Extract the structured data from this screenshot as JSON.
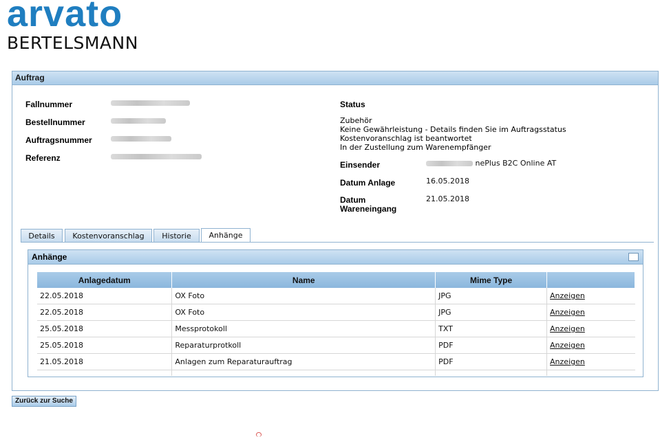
{
  "logo": {
    "brand": "arvato",
    "sub": "BERTELSMANN"
  },
  "panel": {
    "title": "Auftrag"
  },
  "fields": {
    "fallnummer_label": "Fallnummer",
    "bestellnummer_label": "Bestellnummer",
    "auftragsnummer_label": "Auftragsnummer",
    "referenz_label": "Referenz",
    "status_label": "Status",
    "status_lines": [
      "Zubehör",
      "Keine Gewährleistung - Details finden Sie im Auftragsstatus",
      "Kostenvoranschlag ist beantwortet",
      "In der Zustellung zum Warenempfänger"
    ],
    "einsender_label": "Einsender",
    "einsender_value": "nePlus B2C Online AT",
    "datum_anlage_label": "Datum Anlage",
    "datum_anlage_value": "16.05.2018",
    "datum_wareneingang_label_1": "Datum",
    "datum_wareneingang_label_2": "Wareneingang",
    "datum_wareneingang_value": "21.05.2018"
  },
  "tabs": [
    "Details",
    "Kostenvoranschlag",
    "Historie",
    "Anhänge"
  ],
  "active_tab": "Anhänge",
  "attachments": {
    "title": "Anhänge",
    "columns": [
      "Anlagedatum",
      "Name",
      "Mime Type",
      ""
    ],
    "rows": [
      {
        "date": "22.05.2018",
        "name": "OX Foto",
        "mime": "JPG",
        "action": "Anzeigen"
      },
      {
        "date": "22.05.2018",
        "name": "OX Foto",
        "mime": "JPG",
        "action": "Anzeigen"
      },
      {
        "date": "25.05.2018",
        "name": "Messprotokoll",
        "mime": "TXT",
        "action": "Anzeigen"
      },
      {
        "date": "25.05.2018",
        "name": "Reparaturprotkoll",
        "mime": "PDF",
        "action": "Anzeigen"
      },
      {
        "date": "21.05.2018",
        "name": "Anlagen zum Reparaturauftrag",
        "mime": "PDF",
        "action": "Anzeigen"
      }
    ]
  },
  "buttons": {
    "back": "Zurück zur Suche"
  },
  "colors": {
    "brand": "#1f7ec0",
    "header": "#a9cbe8",
    "border": "#8fb2d0"
  }
}
